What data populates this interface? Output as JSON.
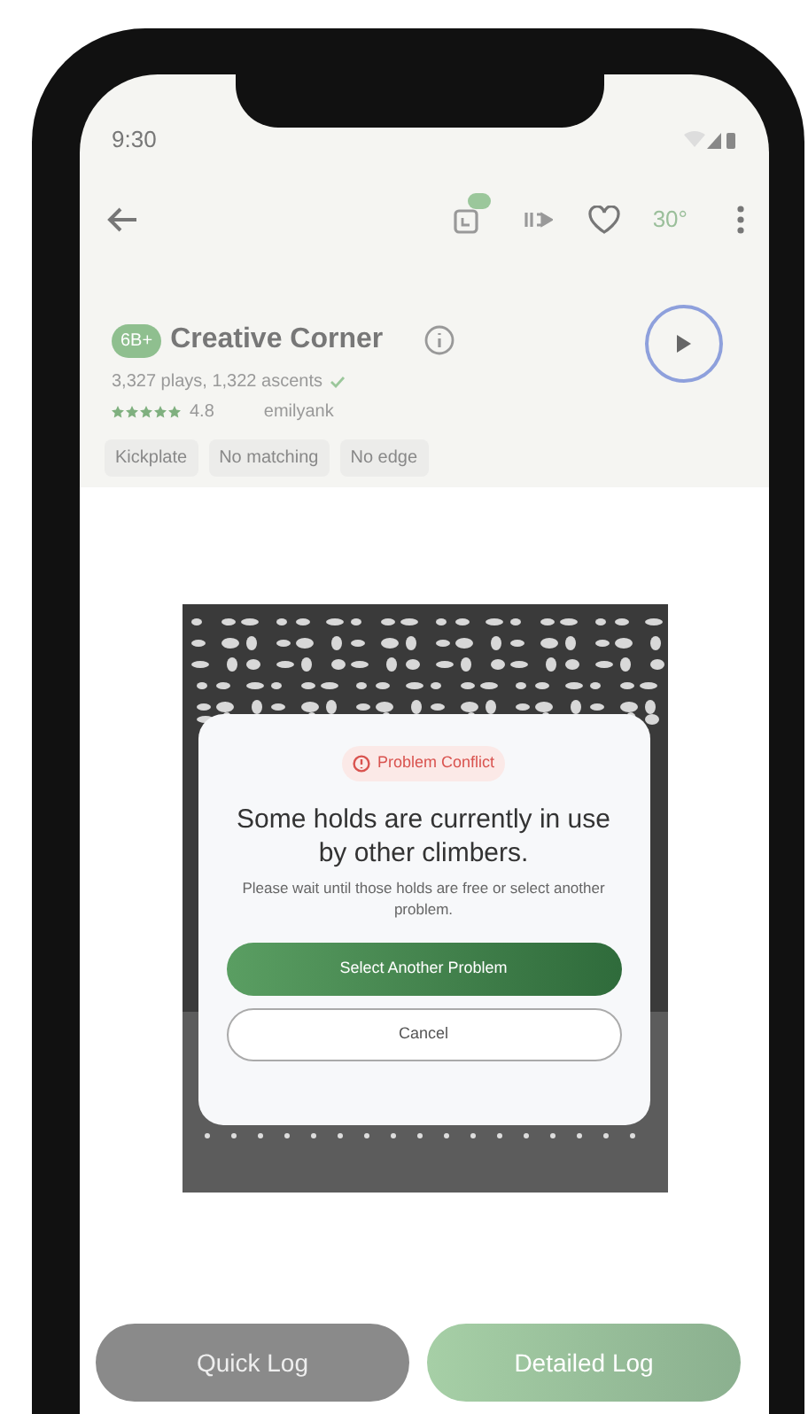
{
  "status_bar": {
    "time": "9:30"
  },
  "header": {
    "chat_badge": true,
    "angle": "30°",
    "favorite": false
  },
  "problem": {
    "grade": "6B+",
    "title": "Creative Corner",
    "stats": "3,327 plays, 1,322 ascents",
    "verified": true,
    "stars": 5,
    "rating": "4.8",
    "setter": "emilyank"
  },
  "tags": [
    "Kickplate",
    "No matching",
    "No edge"
  ],
  "dialog": {
    "badge": "Problem Conflict",
    "title": "Some holds are currently in use by other climbers.",
    "message": "Please wait until those holds are free or select another problem.",
    "buttons": [
      {
        "label": "Select Another Problem",
        "kind": "primary"
      },
      {
        "label": "Cancel",
        "kind": "secondary"
      }
    ]
  },
  "actions": [
    {
      "label": "Quick Log",
      "kind": "secondary"
    },
    {
      "label": "Detailed Log",
      "kind": "primary"
    }
  ]
}
